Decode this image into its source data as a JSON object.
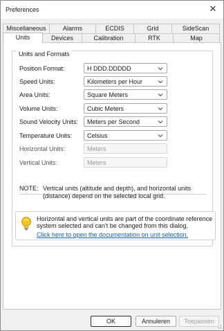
{
  "window": {
    "title": "Preferences",
    "close_glyph": "✕"
  },
  "tabs": {
    "row1": [
      "Miscellaneous",
      "Alarms",
      "ECDIS",
      "Grid",
      "SideScan"
    ],
    "row2": [
      "Units",
      "Devices",
      "Calibration",
      "RTK",
      "Map"
    ],
    "active": "Units"
  },
  "units_group": {
    "title": "Units and Formats",
    "rows": [
      {
        "label": "Position Format:",
        "value": "H DDD.DDDDD",
        "enabled": true
      },
      {
        "label": "Speed Units:",
        "value": "Kilometers per Hour",
        "enabled": true
      },
      {
        "label": "Area Units:",
        "value": "Square Meters",
        "enabled": true
      },
      {
        "label": "Volume Units:",
        "value": "Cubic Meters",
        "enabled": true
      },
      {
        "label": "Sound Velocity Units:",
        "value": "Meters per Second",
        "enabled": true
      },
      {
        "label": "Temperature Units:",
        "value": "Celsius",
        "enabled": true
      },
      {
        "label": "Horizontal Units:",
        "value": "Meters",
        "enabled": false
      },
      {
        "label": "Vertical Units:",
        "value": "Meters",
        "enabled": false
      }
    ],
    "note_label": "NOTE:",
    "note_text": "Vertical units (altitude and depth), and horizontal units (distance) depend on the selected local grid."
  },
  "info": {
    "icon": "lightbulb-icon",
    "text": "Horizontal and vertical units are part of the coordinate reference system selected and can't be changed from this dialog.",
    "link": "Click here to open the documentation on unit selection."
  },
  "buttons": {
    "ok": "OK",
    "cancel": "Annuleren",
    "apply": "Toepassen"
  },
  "colors": {
    "link": "#0563c1",
    "bulb": "#f5c518"
  }
}
